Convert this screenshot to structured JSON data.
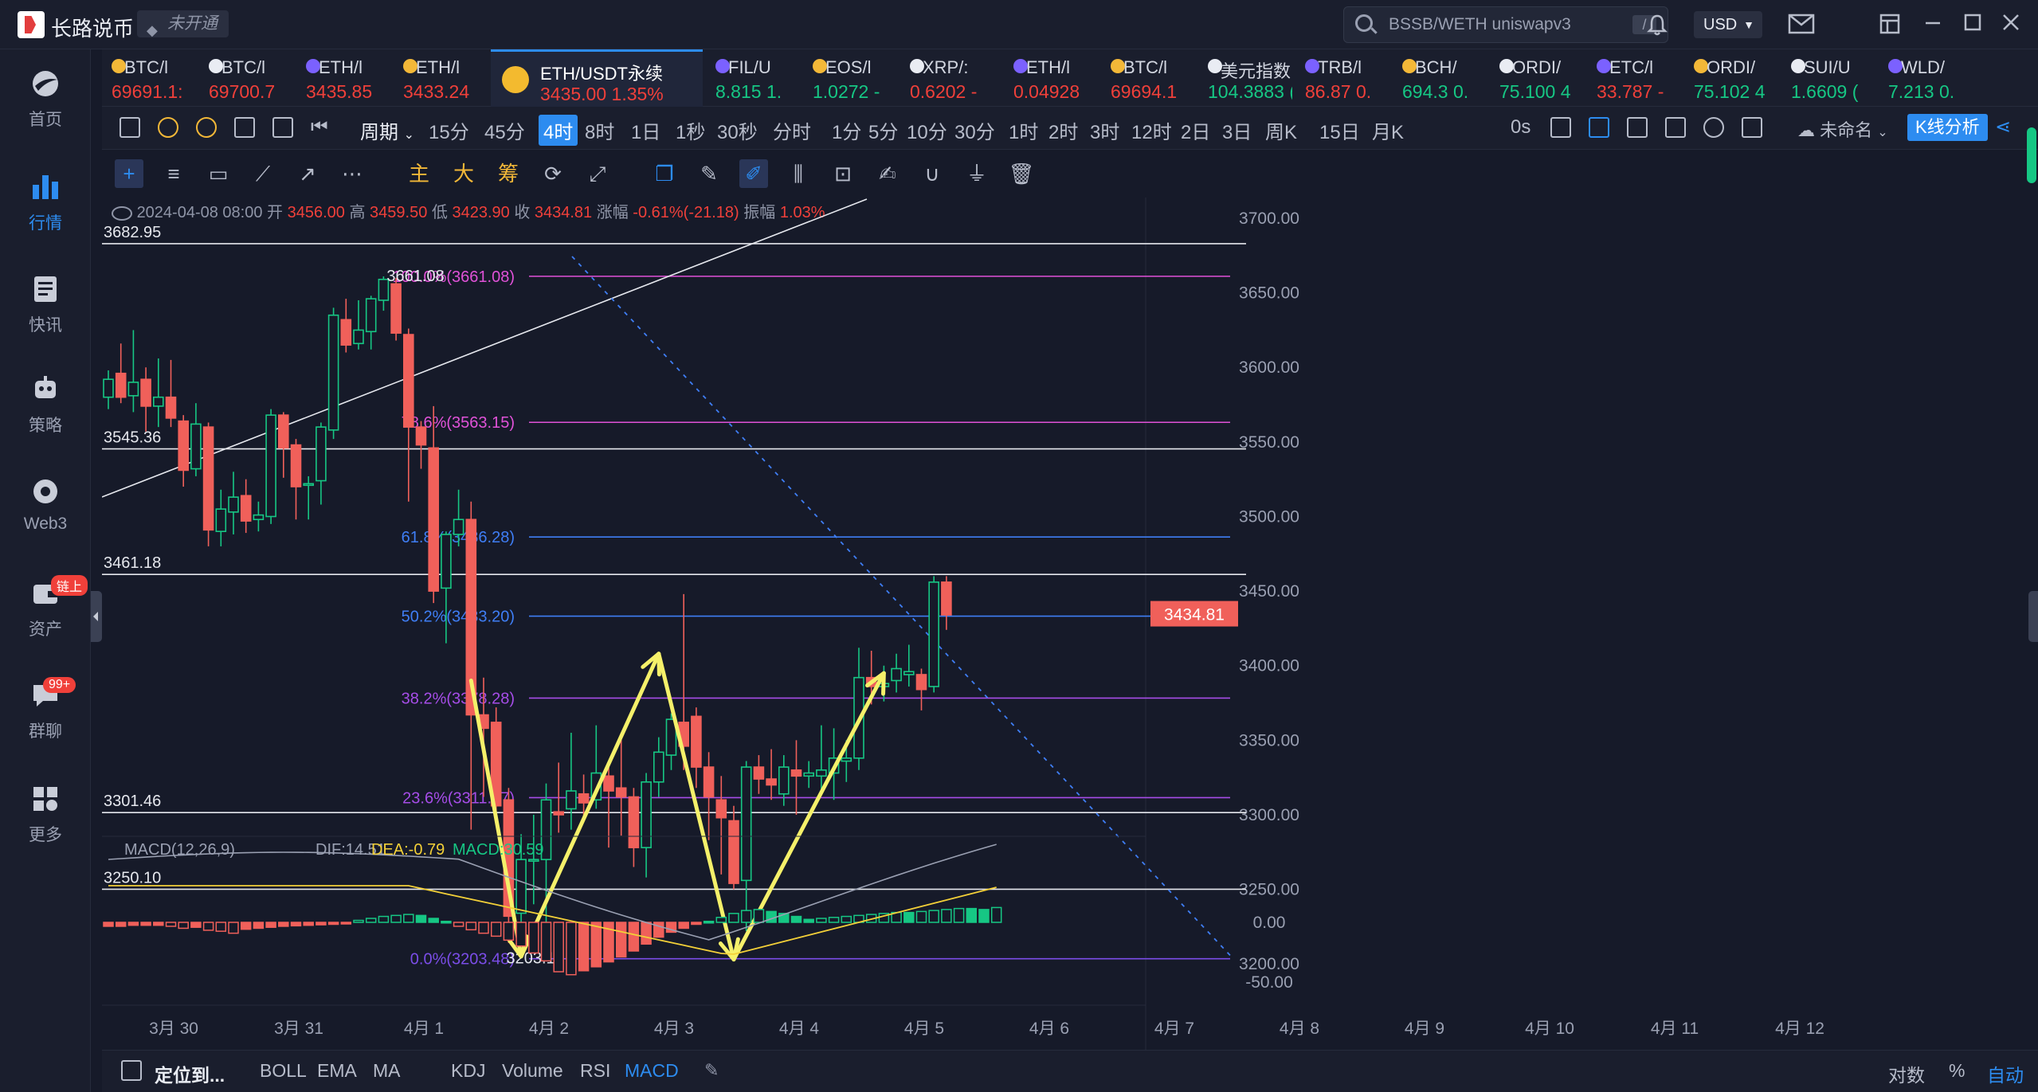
{
  "app": {
    "title": "长路说币",
    "account_status": "未开通"
  },
  "search": {
    "placeholder": "BSSB/WETH uniswapv3",
    "shortcut": "/"
  },
  "currency": {
    "selected": "USD"
  },
  "sidebar": {
    "items": [
      {
        "label": "首页",
        "icon": "home-icon"
      },
      {
        "label": "行情",
        "icon": "market-bars-icon",
        "active": true
      },
      {
        "label": "快讯",
        "icon": "news-icon"
      },
      {
        "label": "策略",
        "icon": "robot-icon"
      },
      {
        "label": "Web3",
        "icon": "web3-icon"
      },
      {
        "label": "资产",
        "icon": "wallet-icon",
        "badge": "链上"
      },
      {
        "label": "群聊",
        "icon": "chat-icon",
        "badge": "99+"
      },
      {
        "label": "更多",
        "icon": "more-grid-icon"
      }
    ]
  },
  "tickers": [
    {
      "name": "BTC/l",
      "price": "69691.1:",
      "color": "#f0403a"
    },
    {
      "name": "BTC/l",
      "price": "69700.7",
      "color": "#f0403a"
    },
    {
      "name": "ETH/l",
      "price": "3435.85",
      "color": "#f0403a"
    },
    {
      "name": "ETH/l",
      "price": "3433.24",
      "color": "#f0403a"
    },
    {
      "name": "ETH/USDT永续",
      "price": "3435.00  1.35%",
      "color": "#f0403a",
      "active": true
    },
    {
      "name": "FIL/U",
      "price": "8.815  1.",
      "color": "#16c784"
    },
    {
      "name": "EOS/l",
      "price": "1.0272 -",
      "color": "#16c784"
    },
    {
      "name": "XRP/:",
      "price": "0.6202 -",
      "color": "#f0403a"
    },
    {
      "name": "ETH/l",
      "price": "0.04928",
      "color": "#f0403a"
    },
    {
      "name": "BTC/l",
      "price": "69694.1",
      "color": "#f0403a"
    },
    {
      "name": "美元指数",
      "price": "104.3883 (",
      "color": "#16c784"
    },
    {
      "name": "TRB/l",
      "price": "86.87  0.",
      "color": "#f0403a"
    },
    {
      "name": "BCH/",
      "price": "694.3  0.",
      "color": "#16c784"
    },
    {
      "name": "ORDI/",
      "price": "75.100 4",
      "color": "#16c784"
    },
    {
      "name": "ETC/l",
      "price": "33.787 -",
      "color": "#f0403a"
    },
    {
      "name": "ORDI/",
      "price": "75.102 4",
      "color": "#16c784"
    },
    {
      "name": "SUI/U",
      "price": "1.6609  (",
      "color": "#16c784"
    },
    {
      "name": "WLD/",
      "price": "7.213  0.",
      "color": "#16c784"
    }
  ],
  "period_bar": {
    "period_dropdown": "周期",
    "periods": [
      "15分",
      "45分",
      "4时",
      "8时",
      "1日",
      "1秒",
      "30秒",
      "分时",
      "1分",
      "5分",
      "10分",
      "30分",
      "1时",
      "2时",
      "3时",
      "12时",
      "2日",
      "3日",
      "周K",
      "15日",
      "月K"
    ],
    "active_period": "4时",
    "countdown": "0s",
    "layout_name": "未命名",
    "analysis_button": "K线分析"
  },
  "draw_tools": {
    "main": "主",
    "big": "大",
    "chip": "筹"
  },
  "ohlc": {
    "date": "2024-04-08 08:00",
    "open_label": "开",
    "open": "3456.00",
    "high_label": "高",
    "high": "3459.50",
    "low_label": "低",
    "low": "3423.90",
    "close_label": "收",
    "close": "3434.81",
    "change_label": "涨幅",
    "change": "-0.61%(-21.18)",
    "amp_label": "振幅",
    "amp": "1.03%"
  },
  "chart_data": {
    "type": "candlestick",
    "symbol": "ETH/USDT永续",
    "interval": "4时",
    "y_axis_ticks": [
      3700,
      3650,
      3600,
      3550,
      3500,
      3450,
      3400,
      3350,
      3300,
      3250,
      3200
    ],
    "y_axis_labels": [
      "3700.00",
      "3650.00",
      "3600.00",
      "3550.00",
      "3500.00",
      "3450.00",
      "3400.00",
      "3350.00",
      "3300.00",
      "3250.00",
      "3200.00"
    ],
    "current_price": 3434.81,
    "current_price_label": "3434.81",
    "x_axis_labels": [
      "3月 30",
      "3月 31",
      "4月 1",
      "4月 2",
      "4月 3",
      "4月 4",
      "4月 5",
      "4月 6",
      "4月 7",
      "4月 8",
      "4月 9",
      "4月 10",
      "4月 11",
      "4月 12"
    ],
    "horizontal_levels": [
      {
        "value": 3682.95,
        "label": "3682.95"
      },
      {
        "value": 3545.36,
        "label": "3545.36"
      },
      {
        "value": 3461.18,
        "label": "3461.18"
      },
      {
        "value": 3301.46,
        "label": "3301.46"
      },
      {
        "value": 3250.1,
        "label": "3250.10"
      }
    ],
    "fibonacci": [
      {
        "ratio": "100.0%",
        "value": 3661.08,
        "label": "100.0%(3661.08)",
        "color": "#e052d8"
      },
      {
        "ratio": "78.6%",
        "value": 3563.15,
        "label": "78.6%(3563.15)",
        "color": "#e052d8"
      },
      {
        "ratio": "61.8%",
        "value": 3486.28,
        "label": "61.8%(3486.28)",
        "color": "#3f7ef5"
      },
      {
        "ratio": "50.2%",
        "value": 3433.2,
        "label": "50.2%(3433.20)",
        "color": "#3f7ef5"
      },
      {
        "ratio": "38.2%",
        "value": 3378.28,
        "label": "38.2%(3378.28)",
        "color": "#a64de8"
      },
      {
        "ratio": "23.6%",
        "value": 3311.47,
        "label": "23.6%(3311.47)",
        "color": "#a64de8"
      },
      {
        "ratio": "0.0%",
        "value": 3203.48,
        "label": "0.0%(3203.48)",
        "color": "#7b4de8"
      }
    ],
    "high_marker": "3661.08",
    "low_marker": "3203.12",
    "candles": [
      [
        3580,
        3592,
        3572,
        3598
      ],
      [
        3596,
        3580,
        3576,
        3616
      ],
      [
        3581,
        3590,
        3570,
        3625
      ],
      [
        3592,
        3574,
        3557,
        3600
      ],
      [
        3574,
        3580,
        3560,
        3606
      ],
      [
        3580,
        3566,
        3560,
        3605
      ],
      [
        3564,
        3531,
        3520,
        3568
      ],
      [
        3532,
        3562,
        3527,
        3576
      ],
      [
        3560,
        3491,
        3480,
        3563
      ],
      [
        3490,
        3505,
        3480,
        3518
      ],
      [
        3503,
        3513,
        3488,
        3530
      ],
      [
        3514,
        3497,
        3489,
        3525
      ],
      [
        3498,
        3501,
        3490,
        3510
      ],
      [
        3500,
        3568,
        3495,
        3572
      ],
      [
        3568,
        3546,
        3526,
        3570
      ],
      [
        3548,
        3520,
        3498,
        3552
      ],
      [
        3522,
        3522,
        3498,
        3527
      ],
      [
        3524,
        3560,
        3508,
        3563
      ],
      [
        3558,
        3635,
        3552,
        3640
      ],
      [
        3632,
        3615,
        3610,
        3646
      ],
      [
        3616,
        3625,
        3612,
        3645
      ],
      [
        3624,
        3646,
        3612,
        3648
      ],
      [
        3645,
        3659,
        3638,
        3661
      ],
      [
        3656,
        3623,
        3618,
        3660
      ],
      [
        3622,
        3560,
        3510,
        3626
      ],
      [
        3560,
        3548,
        3532,
        3564
      ],
      [
        3546,
        3450,
        3442,
        3574
      ],
      [
        3452,
        3488,
        3415,
        3490
      ],
      [
        3488,
        3498,
        3480,
        3518
      ],
      [
        3498,
        3367,
        3290,
        3510
      ],
      [
        3367,
        3358,
        3312,
        3392
      ],
      [
        3362,
        3306,
        3300,
        3372
      ],
      [
        3310,
        3232,
        3214,
        3318
      ],
      [
        3234,
        3270,
        3224,
        3287
      ],
      [
        3270,
        3270,
        3240,
        3300
      ],
      [
        3270,
        3310,
        3203,
        3321
      ],
      [
        3302,
        3300,
        3288,
        3335
      ],
      [
        3304,
        3316,
        3290,
        3355
      ],
      [
        3314,
        3308,
        3296,
        3327
      ],
      [
        3310,
        3328,
        3304,
        3360
      ],
      [
        3326,
        3316,
        3278,
        3336
      ],
      [
        3318,
        3312,
        3286,
        3355
      ],
      [
        3312,
        3278,
        3265,
        3318
      ],
      [
        3278,
        3322,
        3258,
        3328
      ],
      [
        3322,
        3342,
        3312,
        3352
      ],
      [
        3340,
        3364,
        3330,
        3368
      ],
      [
        3362,
        3346,
        3330,
        3448
      ],
      [
        3366,
        3332,
        3318,
        3372
      ],
      [
        3332,
        3312,
        3283,
        3342
      ],
      [
        3310,
        3298,
        3260,
        3326
      ],
      [
        3296,
        3254,
        3250,
        3306
      ],
      [
        3256,
        3332,
        3222,
        3336
      ],
      [
        3332,
        3324,
        3314,
        3340
      ],
      [
        3324,
        3320,
        3310,
        3344
      ],
      [
        3314,
        3332,
        3306,
        3340
      ],
      [
        3330,
        3326,
        3300,
        3350
      ],
      [
        3326,
        3328,
        3318,
        3336
      ],
      [
        3326,
        3330,
        3314,
        3360
      ],
      [
        3328,
        3338,
        3310,
        3358
      ],
      [
        3336,
        3338,
        3322,
        3350
      ],
      [
        3338,
        3392,
        3330,
        3412
      ],
      [
        3392,
        3386,
        3374,
        3410
      ],
      [
        3386,
        3388,
        3376,
        3400
      ],
      [
        3390,
        3398,
        3382,
        3408
      ],
      [
        3394,
        3396,
        3386,
        3414
      ],
      [
        3394,
        3384,
        3370,
        3398
      ],
      [
        3386,
        3456,
        3382,
        3460
      ],
      [
        3456,
        3434,
        3424,
        3460
      ]
    ],
    "macd": {
      "label": "MACD(12,26,9)",
      "dif": "14.51",
      "dea": "-0.79",
      "macd": "30.59",
      "zero_label": "0.00",
      "neg_label": "-50.00",
      "histogram": [
        -8,
        -8,
        -6,
        -6,
        -6,
        -8,
        -12,
        -10,
        -16,
        -18,
        -22,
        -14,
        -12,
        -10,
        -8,
        -7,
        -6,
        -5,
        -4,
        -2,
        4,
        8,
        12,
        14,
        16,
        14,
        8,
        2,
        -8,
        -15,
        -22,
        -28,
        -36,
        -48,
        -62,
        -78,
        -100,
        -106,
        -98,
        -90,
        -80,
        -70,
        -58,
        -44,
        -30,
        -20,
        -12,
        -4,
        2,
        10,
        18,
        24,
        26,
        22,
        18,
        12,
        6,
        8,
        10,
        12,
        14,
        16,
        18,
        20,
        20,
        22,
        24,
        26,
        28,
        28,
        26,
        30
      ]
    }
  },
  "indicator_bar": {
    "locate": "定位到...",
    "items": [
      "BOLL",
      "EMA",
      "MA",
      "KDJ",
      "Volume",
      "RSI",
      "MACD"
    ],
    "active": "MACD",
    "right_items": [
      "对数",
      "%",
      "自动"
    ]
  }
}
